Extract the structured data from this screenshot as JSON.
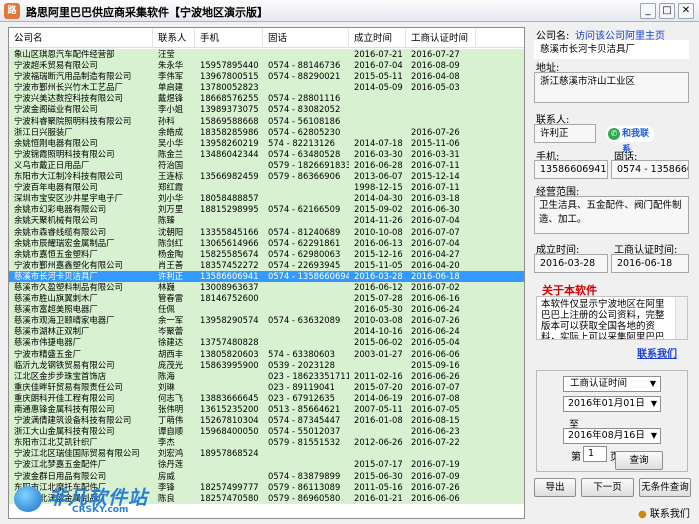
{
  "window": {
    "title": "路思阿里巴巴供应商采集软件【宁波地区演示版】",
    "app_icon": "app-logo-icon",
    "buttons": {
      "minimize": "_",
      "maximize": "□",
      "close": "✕"
    }
  },
  "table": {
    "columns": [
      "公司名",
      "联系人",
      "手机",
      "固话",
      "成立时间",
      "工商认证时间"
    ],
    "rows": [
      [
        "象山区琪恩汽车配件经营部",
        "汪莹",
        "",
        "",
        "2016-07-21",
        "2016-07-27"
      ],
      [
        "宁波超禾贸易有限公司",
        "朱永华",
        "15957895440",
        "0574 - 88146736",
        "2016-07-04",
        "2016-08-09"
      ],
      [
        "宁波福瑞断汽用品制造有限公司",
        "李伟军",
        "13967800515",
        "0574 - 88290021",
        "2015-05-11",
        "2016-04-08"
      ],
      [
        "宁波市鄞州长兴竹木工艺品厂",
        "单启建",
        "13780052823",
        "",
        "2014-05-09",
        "2016-05-03"
      ],
      [
        "宁波兴美达数控科技有限公司",
        "戴煜锋",
        "18668576255",
        "0574 - 28801116",
        "",
        ""
      ],
      [
        "宁波金阁磁业有限公司",
        "李小姐",
        "13989373075",
        "0574 - 83082052",
        "",
        ""
      ],
      [
        "宁波科睿聚院照明科技有限公司",
        "孙科",
        "15869588668",
        "0574 - 56108186",
        "",
        ""
      ],
      [
        "浙江日兴服装厂",
        "余皓成",
        "18358285986",
        "0574 - 62805230",
        "",
        "2016-07-26"
      ],
      [
        "余姚恒刚电器有限公司",
        "吴小华",
        "13958260219",
        "574 - 82213126",
        "2014-07-18",
        "2015-11-06"
      ],
      [
        "宁波锦霞照明科技有限公司",
        "陈金兰",
        "13486042344",
        "0574 - 63480528",
        "2016-03-30",
        "2016-03-31"
      ],
      [
        "义乌市戴正日用品厂",
        "符治国",
        "",
        "0579 - 18266918330",
        "2016-06-28",
        "2016-07-11"
      ],
      [
        "东阳市大江制冷科技有限公司",
        "王连标",
        "13566982459",
        "0579 - 86366906",
        "2013-06-07",
        "2015-12-14"
      ],
      [
        "宁波百年电器有限公司",
        "郑红霞",
        "",
        "",
        "1998-12-15",
        "2016-07-11"
      ],
      [
        "深圳市宝安区沙井星宇电子厂",
        "刘小华",
        "18058488857",
        "",
        "2014-04-30",
        "2016-03-18"
      ],
      [
        "余姚市幻彩电器有限公司",
        "刘万里",
        "18815298995",
        "0574 - 62166509",
        "2015-09-02",
        "2016-06-30"
      ],
      [
        "余姚天聚机械有限公司",
        "陈臻",
        "",
        "",
        "2014-11-26",
        "2016-07-04"
      ],
      [
        "余姚市森睿线缆有限公司",
        "沈朝阳",
        "13355845166",
        "0574 - 81240689",
        "2010-10-08",
        "2016-07-07"
      ],
      [
        "余姚市辰耀瑞宏金属制品厂",
        "陈剑红",
        "13065614966",
        "0574 - 62291861",
        "2016-06-13",
        "2016-07-04"
      ],
      [
        "余姚市嘉恒五金塑料厂",
        "杨金陶",
        "15825585674",
        "0574 - 62980063",
        "2015-12-16",
        "2016-04-27"
      ],
      [
        "宁波市鄞州嘉鑫塑化有限公司",
        "肖王善",
        "18357452272",
        "0574 - 22693945",
        "2015-11-05",
        "2016-04-20"
      ],
      [
        "慈溪市长河卡贝洁具厂",
        "许利正",
        "13586606941",
        "0574 - 13586606941",
        "2016-03-28",
        "2016-06-18"
      ],
      [
        "慈溪市久盈塑料制品有限公司",
        "林巍",
        "13008963637",
        "",
        "2016-06-12",
        "2016-07-02"
      ],
      [
        "慈溪市胜山旗翼刺木厂",
        "管春雷",
        "18146752600",
        "",
        "2015-07-28",
        "2016-06-16"
      ],
      [
        "慈溪市富超美照电器厂",
        "任佩",
        "",
        "",
        "2016-05-30",
        "2016-06-24"
      ],
      [
        "慈溪市观海卫颐晴家电器厂",
        "余一军",
        "13958290574",
        "0574 - 63632089",
        "2010-03-08",
        "2016-07-26"
      ],
      [
        "慈溪市湖林正双制厂",
        "岑聚蕾",
        "",
        "",
        "2014-10-16",
        "2016-06-24"
      ],
      [
        "慈溪市伟捷电器厂",
        "徐建达",
        "13757480828",
        "",
        "2015-06-02",
        "2016-05-04"
      ],
      [
        "宁波市精盛五金厂",
        "胡西丰",
        "13805820603",
        "574 - 63380603",
        "2003-01-27",
        "2016-06-06"
      ],
      [
        "临沂九龙钢铁贸易有限公司",
        "庞茂光",
        "15863995900",
        "0539 - 2023128",
        "",
        "2015-09-16"
      ],
      [
        "江北区金步步珠宝首饰店",
        "陈海",
        "",
        "023 - 18623351711",
        "2011-02-16",
        "2016-06-26"
      ],
      [
        "重庆佳畔轩贸易有限责任公司",
        "刘琳",
        "",
        "023 - 89119041",
        "2015-07-20",
        "2016-07-07"
      ],
      [
        "重庆朗科开佳工程有限公司",
        "何志飞",
        "13883666645",
        "023 - 67912635",
        "2014-06-19",
        "2016-07-08"
      ],
      [
        "南通惠锋金属科技有限公司",
        "张伟明",
        "13615235200",
        "0513 - 85664621",
        "2007-05-11",
        "2016-07-05"
      ],
      [
        "宁波满倩建筑设备科技有限公司",
        "丁萌伟",
        "15267810304",
        "0574 - 87345447",
        "2016-01-08",
        "2016-08-15"
      ],
      [
        "浙江大山金属科技有限公司",
        "谭自顺",
        "15968400050",
        "0574 - 55012037",
        "",
        "2016-06-23"
      ],
      [
        "东阳市江北艾凯针织厂",
        "李杰",
        "",
        "0579 - 81551532",
        "2012-06-26",
        "2016-07-22"
      ],
      [
        "宁波江北区瑞佳国际贸易有限公司",
        "刘宏鸿",
        "18957868524",
        "",
        "",
        ""
      ],
      [
        "宁波江北梦嘉五金配件厂",
        "徐丹莲",
        "",
        "",
        "2015-07-17",
        "2016-07-19"
      ],
      [
        "宁波金群日用品有限公司",
        "房威",
        "",
        "0574 - 83879899",
        "2015-06-30",
        "2016-07-09"
      ],
      [
        "东阳市江北摩托车配件厂",
        "李锋",
        "18257499777",
        "0579 - 86113089",
        "2011-05-16",
        "2016-07-26"
      ],
      [
        "宁波江北沃盛金属制品厂",
        "陈良",
        "18257470580",
        "0579 - 86960580",
        "2016-01-21",
        "2016-06-06"
      ]
    ],
    "selected_row": 20
  },
  "detail": {
    "company_label": "公司名:",
    "homepage_link": "访问该公司阿里主页",
    "company_value": "慈溪市长河卡贝洁具厂",
    "address_label": "地址:",
    "address_value": "浙江慈溪市浒山工业区",
    "contact_label": "联系人:",
    "contact_value": "许利正",
    "contact_badge": "和我联系",
    "mobile_label": "手机:",
    "phone_label": "固话:",
    "mobile_value": "13586606941",
    "phone_value": "0574 - 13586606941",
    "scope_label": "经营范围:",
    "scope_value": "卫生洁具、五金配件、阀门配件制造、加工。",
    "founded_label": "成立时间:",
    "cert_label": "工商认证时间:",
    "founded_value": "2016-03-28",
    "cert_value": "2016-06-18"
  },
  "about": {
    "title": "关于本软件",
    "text": "本软件仅显示宁波地区在阿里巴巴上注册的公司资料，完整版本可以获取全国各地的资料，实际上可以采集阿里巴巴上所有的供应商信息。",
    "contact_link": "联系我们"
  },
  "query": {
    "field_select": "工商认证时间",
    "date_from": "2016年01月01日",
    "to_label": "至",
    "date_to": "2016年08月16日",
    "page_prefix": "第",
    "page_value": "1",
    "page_suffix": "页",
    "query_button": "查询"
  },
  "actions": {
    "export": "导出",
    "next_page": "下一页",
    "no_condition_query": "无条件查询"
  },
  "status": {
    "contact": "联系我们"
  },
  "watermark": {
    "title": "非凡软件站",
    "subtitle": "CRSKY.com"
  }
}
